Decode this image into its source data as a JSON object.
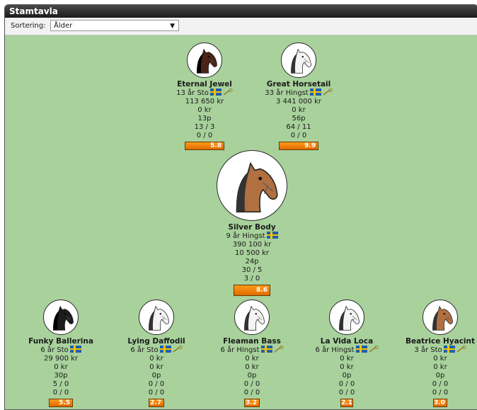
{
  "window": {
    "title": "Stamtavla"
  },
  "sort": {
    "label": "Sortering:",
    "value": "Ålder"
  },
  "horses": {
    "dam": {
      "name": "Eternal Jewel",
      "age_line": "13 år Sto",
      "earnings": "113 650 kr",
      "season": "0 kr",
      "points": "13p",
      "starts_wins": "13 / 3",
      "extra": "0 / 0",
      "rating": "5.8",
      "coat": "#4a2416"
    },
    "sire": {
      "name": "Great Horsetail",
      "age_line": "33 år Hingst",
      "earnings": "3 441 000 kr",
      "season": "0 kr",
      "points": "56p",
      "starts_wins": "64 / 11",
      "extra": "0 / 0",
      "rating": "9.9",
      "coat": "#f4f4f4"
    },
    "main": {
      "name": "Silver Body",
      "age_line": "9 år Hingst",
      "earnings": "390 100 kr",
      "season": "10 500 kr",
      "points": "24p",
      "starts_wins": "30 / 5",
      "extra": "3 / 0",
      "rating": "8.6",
      "coat": "#b07040"
    },
    "child1": {
      "name": "Funky Ballerina",
      "age_line": "6 år Sto",
      "earnings": "29 900 kr",
      "season": "0 kr",
      "points": "30p",
      "starts_wins": "5 / 0",
      "extra": "0 / 0",
      "rating": "5.5",
      "coat": "#1c1c1c"
    },
    "child2": {
      "name": "Lying Daffodil",
      "age_line": "6 år Sto",
      "earnings": "0 kr",
      "season": "0 kr",
      "points": "0p",
      "starts_wins": "0 / 0",
      "extra": "0 / 0",
      "rating": "2.7",
      "coat": "#f4f4f4"
    },
    "child3": {
      "name": "Fleaman Bass",
      "age_line": "6 år Hingst",
      "earnings": "0 kr",
      "season": "0 kr",
      "points": "0p",
      "starts_wins": "0 / 0",
      "extra": "0 / 0",
      "rating": "3.2",
      "coat": "#f4f4f4"
    },
    "child4": {
      "name": "La Vida Loca",
      "age_line": "6 år Hingst",
      "earnings": "0 kr",
      "season": "0 kr",
      "points": "0p",
      "starts_wins": "0 / 0",
      "extra": "0 / 0",
      "rating": "2.1",
      "coat": "#f4f4f4"
    },
    "child5": {
      "name": "Beatrice Hyacint",
      "age_line": "3 år Sto",
      "earnings": "0 kr",
      "season": "0 kr",
      "points": "0p",
      "starts_wins": "0 / 0",
      "extra": "0 / 0",
      "rating": "3.0",
      "coat": "#b07040"
    }
  }
}
